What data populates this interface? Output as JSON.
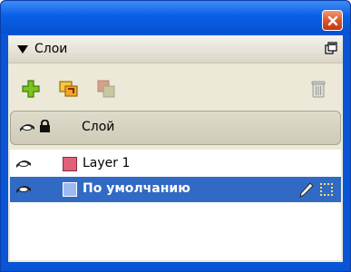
{
  "window": {
    "close_label": "✕"
  },
  "panel": {
    "title": "Слои",
    "column_header": {
      "title": "Слой"
    },
    "layers": [
      {
        "name": "Layer 1",
        "color": "#e0607a",
        "selected": false
      },
      {
        "name": "По умолчанию",
        "color": "#9cb9f2",
        "selected": true
      }
    ]
  },
  "colors": {
    "titlebar_blue": "#0a5ddc",
    "selection_blue": "#316ac5",
    "panel_bg": "#ece9d8",
    "close_red": "#d9522a"
  },
  "icons": {
    "new_layer": "plus-icon",
    "new_sublayer": "new-sublayer-icon",
    "duplicate": "duplicate-layer-icon",
    "delete": "trash-icon",
    "visibility": "eye-icon",
    "lock": "lock-icon",
    "edit": "pencil-icon",
    "grip": "dot-grid-icon",
    "panel_menu": "panel-menu-icon",
    "collapse": "triangle-down-icon"
  }
}
